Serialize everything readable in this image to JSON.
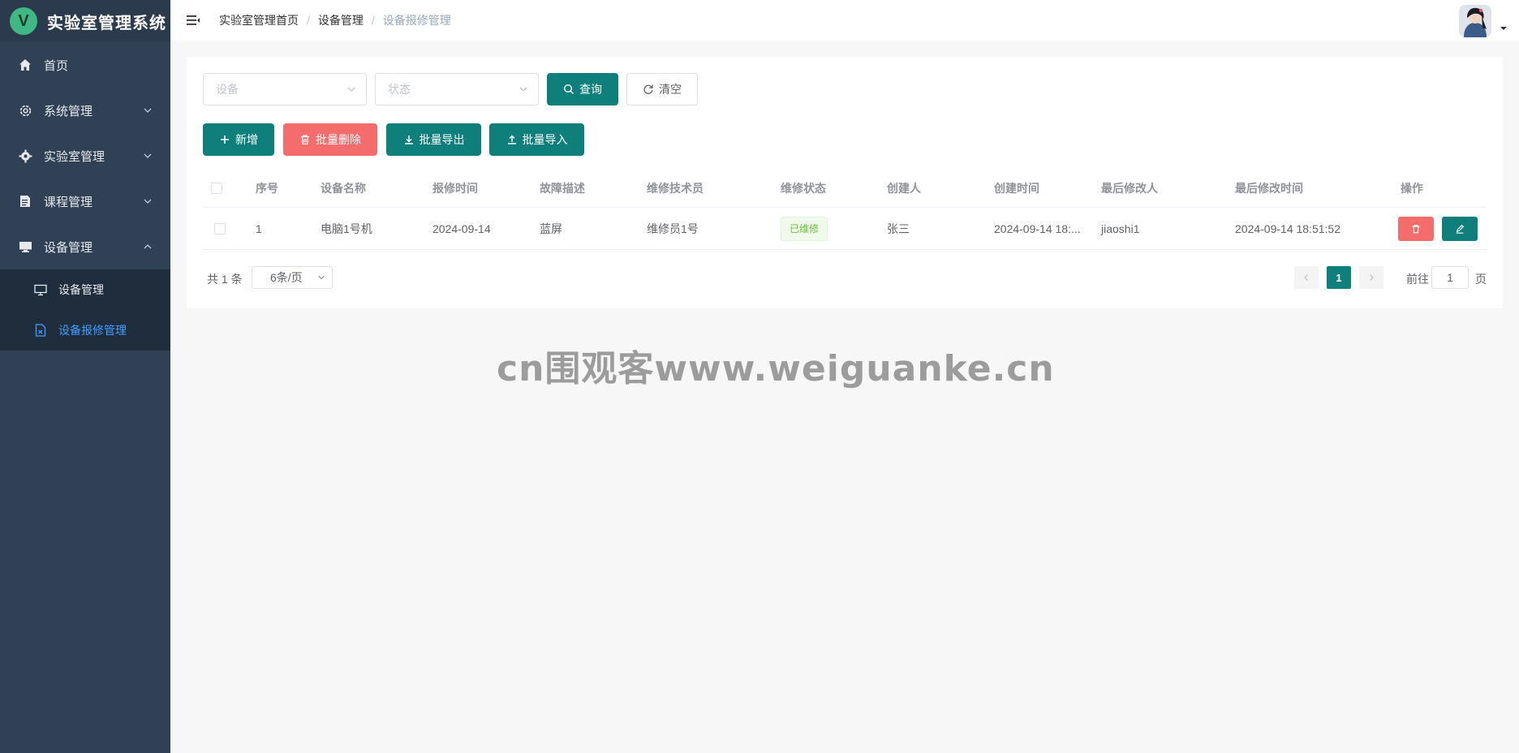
{
  "app": {
    "title": "实验室管理系统",
    "logo_letter": "V"
  },
  "sidebar": {
    "items": [
      {
        "label": "首页",
        "icon": "home-icon"
      },
      {
        "label": "系统管理",
        "icon": "gear-icon"
      },
      {
        "label": "实验室管理",
        "icon": "cog-icon"
      },
      {
        "label": "课程管理",
        "icon": "document-icon"
      },
      {
        "label": "设备管理",
        "icon": "monitor-icon"
      }
    ],
    "submenu": [
      {
        "label": "设备管理",
        "icon": "monitor-icon"
      },
      {
        "label": "设备报修管理",
        "icon": "file-icon"
      }
    ]
  },
  "header": {
    "breadcrumb": [
      "实验室管理首页",
      "设备管理",
      "设备报修管理"
    ]
  },
  "filters": {
    "device_placeholder": "设备",
    "status_placeholder": "状态",
    "query_label": "查询",
    "clear_label": "清空"
  },
  "toolbar": {
    "add_label": "新增",
    "batch_delete_label": "批量删除",
    "batch_export_label": "批量导出",
    "batch_import_label": "批量导入"
  },
  "table": {
    "columns": [
      "序号",
      "设备名称",
      "报修时间",
      "故障描述",
      "维修技术员",
      "维修状态",
      "创建人",
      "创建时间",
      "最后修改人",
      "最后修改时间",
      "操作"
    ],
    "rows": [
      {
        "index": "1",
        "device": "电脑1号机",
        "report_time": "2024-09-14",
        "fault": "蓝屏",
        "technician": "维修员1号",
        "status": "已维修",
        "creator": "张三",
        "created_at": "2024-09-14 18:...",
        "modifier": "jiaoshi1",
        "modified_at": "2024-09-14 18:51:52"
      }
    ]
  },
  "pagination": {
    "total": "共 1 条",
    "page_size": "6条/页",
    "current_page": "1",
    "goto_prefix": "前往",
    "goto_value": "1",
    "goto_suffix": "页"
  },
  "watermark": "cn围观客www.weiguanke.cn",
  "colors": {
    "primary": "#0f7f7c",
    "danger": "#f56c6c",
    "sidebar": "#304156",
    "active": "#409eff"
  }
}
